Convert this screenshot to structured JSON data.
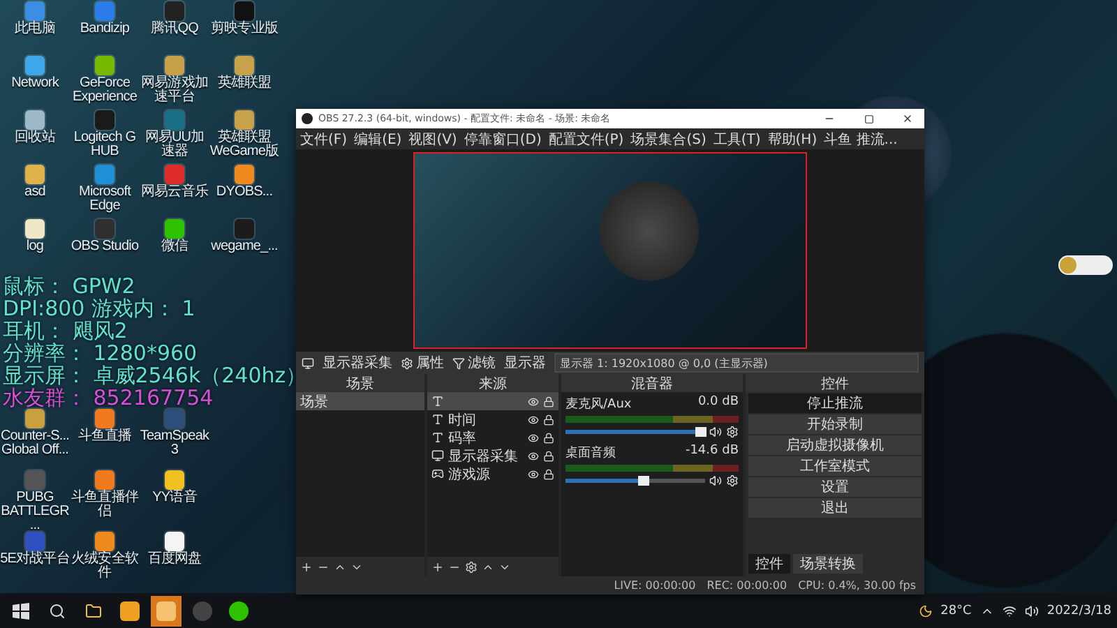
{
  "desktop_icons": [
    {
      "label": "此电脑",
      "color": "#3a8ee6"
    },
    {
      "label": "Bandizip",
      "color": "#2b7de9"
    },
    {
      "label": "腾讯QQ",
      "color": "#222222"
    },
    {
      "label": "剪映专业版",
      "color": "#111111"
    },
    {
      "label": "Network",
      "color": "#3fa7e8"
    },
    {
      "label": "GeForce Experience",
      "color": "#76b900"
    },
    {
      "label": "网易游戏加速平台",
      "color": "#c9a04a"
    },
    {
      "label": "英雄联盟",
      "color": "#c8a24a"
    },
    {
      "label": "回收站",
      "color": "#9fb8c8"
    },
    {
      "label": "Logitech G HUB",
      "color": "#1a1a1a"
    },
    {
      "label": "网易UU加速器",
      "color": "#1a6f86"
    },
    {
      "label": "英雄联盟WeGame版",
      "color": "#c8a24a"
    },
    {
      "label": "asd",
      "color": "#e0b34a"
    },
    {
      "label": "Microsoft Edge",
      "color": "#1f8fd6"
    },
    {
      "label": "网易云音乐",
      "color": "#e02b2b"
    },
    {
      "label": "DYOBS...",
      "color": "#f08a1e"
    },
    {
      "label": "log",
      "color": "#f0e6c8"
    },
    {
      "label": "OBS Studio",
      "color": "#302e31"
    },
    {
      "label": "微信",
      "color": "#2dc100"
    },
    {
      "label": "wegame_...",
      "color": "#1c1c1c"
    }
  ],
  "desktop_icons_lower": [
    {
      "label": "Counter-S... Global Off...",
      "color": "#c8a040"
    },
    {
      "label": "斗鱼直播",
      "color": "#f07a1e"
    },
    {
      "label": "TeamSpeak 3",
      "color": "#2b4f7a"
    },
    {
      "label": "PUBG BATTLEGR...",
      "color": "#555555"
    },
    {
      "label": "斗鱼直播伴侣",
      "color": "#f07a1e"
    },
    {
      "label": "YY语音",
      "color": "#f0c020"
    },
    {
      "label": "5E对战平台",
      "color": "#3050c0"
    },
    {
      "label": "火绒安全软件",
      "color": "#f08a1e"
    },
    {
      "label": "百度网盘",
      "color": "#f4f4f4"
    }
  ],
  "overlay_lines": [
    {
      "text": "鼠标： GPW2",
      "color": "#5fe3cf"
    },
    {
      "text": "DPI:800 游戏内： 1",
      "color": "#5fe3cf"
    },
    {
      "text": "耳机： 飓风2",
      "color": "#5fe3cf"
    },
    {
      "text": "分辨率： 1280*960",
      "color": "#5fe3cf"
    },
    {
      "text": "显示屏： 卓威2546k（240hz）",
      "color": "#5fe3cf"
    },
    {
      "text": "水友群： 852167754",
      "color": "#d64fd6"
    }
  ],
  "obs": {
    "title": "OBS 27.2.3 (64-bit, windows) - 配置文件: 未命名 - 场景: 未命名",
    "menu": [
      "文件(F)",
      "编辑(E)",
      "视图(V)",
      "停靠窗口(D)",
      "配置文件(P)",
      "场景集合(S)",
      "工具(T)",
      "帮助(H)",
      "斗鱼 推流..."
    ],
    "source_toolbar": {
      "name": "显示器采集",
      "properties": "属性",
      "filters": "滤镜",
      "monitor_label": "显示器",
      "monitor_value": "显示器 1: 1920x1080 @ 0,0 (主显示器)"
    },
    "scenes": {
      "header": "场景",
      "items": [
        {
          "name": "场景",
          "selected": true
        }
      ]
    },
    "sources": {
      "header": "来源",
      "items": [
        {
          "kind": "text",
          "selected": true
        },
        {
          "kind": "text",
          "name": "时间",
          "selected": false
        },
        {
          "kind": "text",
          "name": "码率",
          "selected": false
        },
        {
          "kind": "monitor",
          "name": "显示器采集",
          "selected": false
        },
        {
          "kind": "game",
          "name": "游戏源",
          "selected": false
        }
      ]
    },
    "mixer": {
      "header": "混音器",
      "channels": [
        {
          "name": "麦克风/Aux",
          "reading": "0.0 dB",
          "level": 0.97
        },
        {
          "name": "桌面音频",
          "reading": "-14.6 dB",
          "level": 0.56
        }
      ]
    },
    "controls": {
      "header": "控件",
      "buttons": [
        {
          "label": "停止推流",
          "active": true
        },
        {
          "label": "开始录制",
          "active": false
        },
        {
          "label": "启动虚拟摄像机",
          "active": false
        },
        {
          "label": "工作室模式",
          "active": false
        },
        {
          "label": "设置",
          "active": false
        },
        {
          "label": "退出",
          "active": false
        }
      ]
    },
    "dock_tabs": [
      {
        "label": "控件",
        "selected": true
      },
      {
        "label": "场景转换",
        "selected": false
      }
    ],
    "status": {
      "live": "LIVE: 00:00:00",
      "rec": "REC: 00:00:00",
      "cpu": "CPU: 0.4%, 30.00 fps"
    }
  },
  "taskbar": {
    "temperature": "28°C",
    "date": "2022/3/18"
  }
}
